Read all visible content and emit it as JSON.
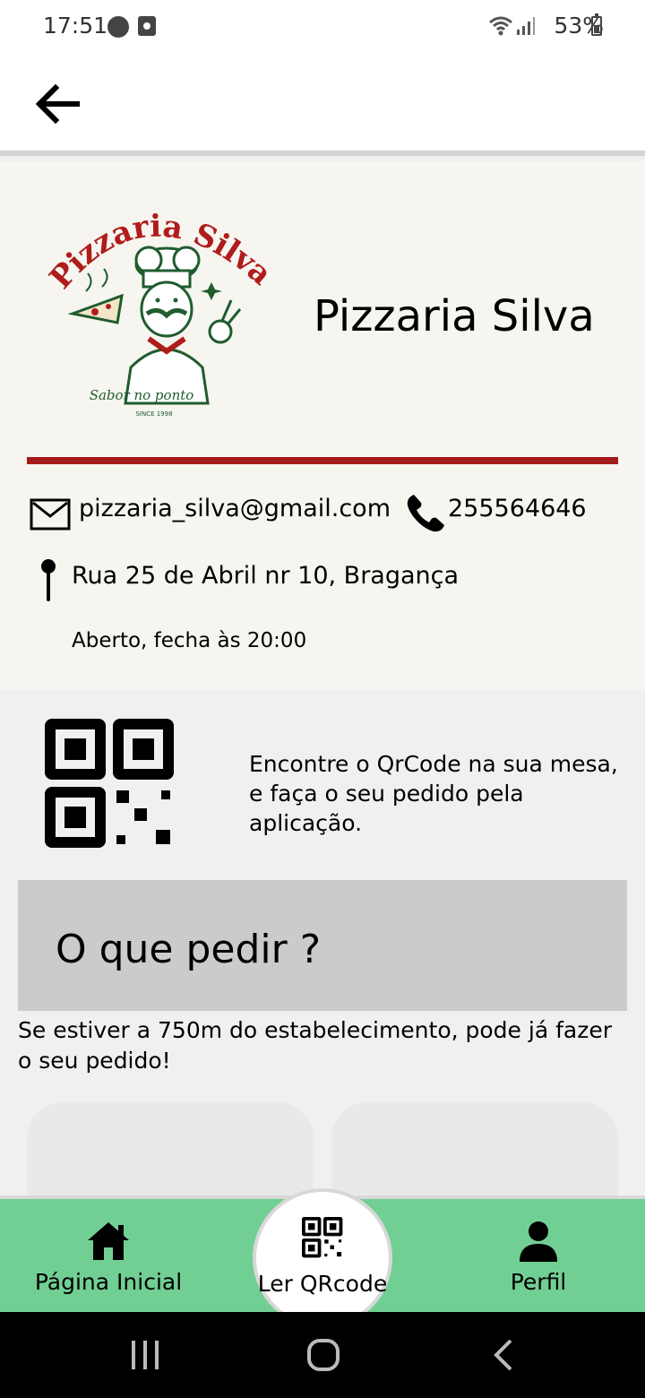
{
  "status_bar": {
    "time": "17:51",
    "battery": "53%"
  },
  "header": {
    "back_icon": "arrow-left-icon"
  },
  "restaurant": {
    "name": "Pizzaria Silva",
    "logo": {
      "title": "Pizzaria Silva",
      "tagline": "Sabor no ponto",
      "since": "SINCE 1998"
    },
    "email": "pizzaria_silva@gmail.com",
    "phone": "255564646",
    "address": "Rua 25 de Abril nr 10, Bragança",
    "hours": "Aberto, fecha às 20:00",
    "accent_color": "#a51a1a"
  },
  "qr_info": {
    "text": "Encontre o QrCode na sua mesa, e faça o seu pedido pela aplicação."
  },
  "order": {
    "title": "O que pedir ?",
    "description": "Se estiver a 750m do estabelecimento, pode já fazer o seu pedido!"
  },
  "bottom_nav": {
    "background": "#72cf94",
    "items": [
      {
        "label": "Página Inicial",
        "icon": "home-icon"
      },
      {
        "label": "Ler QRcode",
        "icon": "qrcode-icon"
      },
      {
        "label": "Perfil",
        "icon": "user-icon"
      }
    ]
  }
}
